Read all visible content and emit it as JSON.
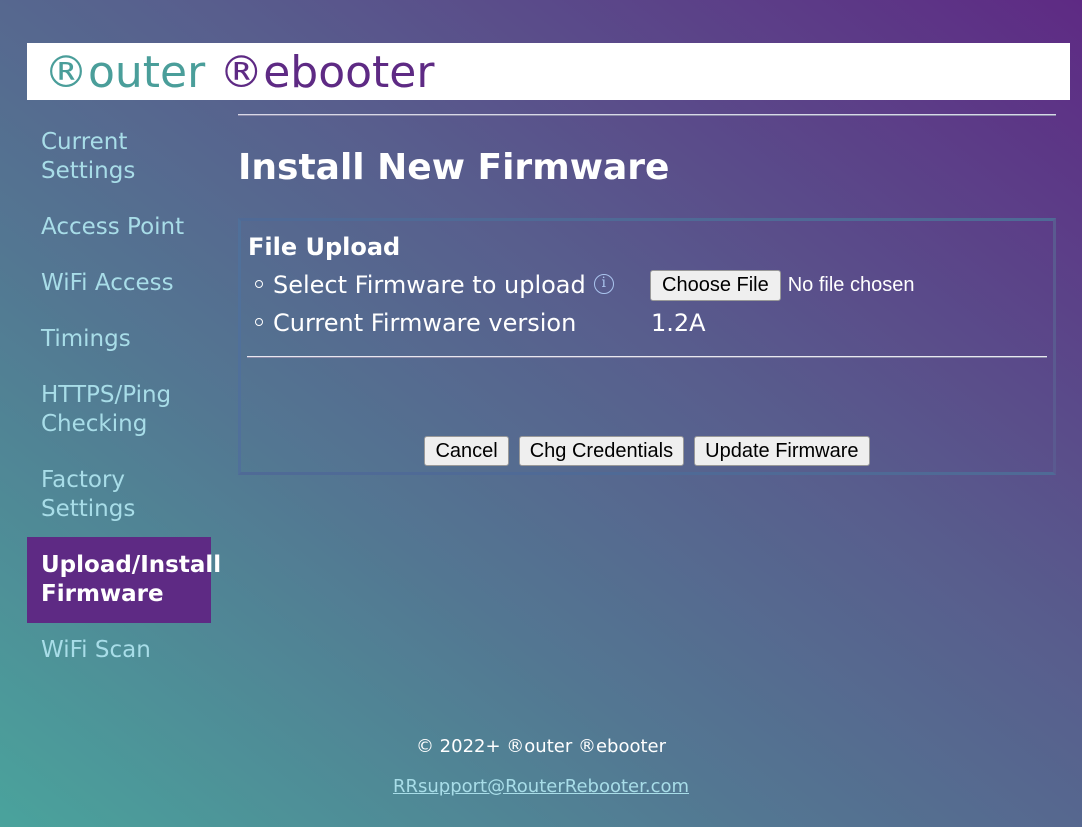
{
  "header": {
    "logo_part1": "®outer",
    "logo_part2": "®ebooter",
    "logo_colors": {
      "part1": "#4a9e9a",
      "part2": "#5e2a84"
    }
  },
  "sidebar": {
    "items": [
      {
        "label_line1": "Current",
        "label_line2": "Settings",
        "active": false
      },
      {
        "label_line1": "Access Point",
        "label_line2": "",
        "active": false
      },
      {
        "label_line1": "WiFi Access",
        "label_line2": "",
        "active": false
      },
      {
        "label_line1": "Timings",
        "label_line2": "",
        "active": false
      },
      {
        "label_line1": "HTTPS/Ping",
        "label_line2": "Checking",
        "active": false
      },
      {
        "label_line1": "Factory",
        "label_line2": "Settings",
        "active": false
      },
      {
        "label_line1": "Upload/Install",
        "label_line2": "Firmware",
        "active": true
      },
      {
        "label_line1": "WiFi Scan",
        "label_line2": "",
        "active": false
      }
    ],
    "active_color": "#5e2a84",
    "text_color": "#a8dde8"
  },
  "main": {
    "title": "Install New Firmware",
    "panel": {
      "title": "File Upload",
      "select_label": "Select Firmware to upload",
      "info_icon": "info-icon",
      "choose_file_label": "Choose File",
      "no_file_text": "No file chosen",
      "version_label": "Current Firmware version",
      "version_value": "1.2A"
    },
    "actions": {
      "cancel_label": "Cancel",
      "credentials_label": "Chg Credentials",
      "update_label": "Update Firmware"
    }
  },
  "footer": {
    "copyright": "© 2022+ ®outer ®ebooter",
    "support_email": "RRsupport@RouterRebooter.com"
  }
}
